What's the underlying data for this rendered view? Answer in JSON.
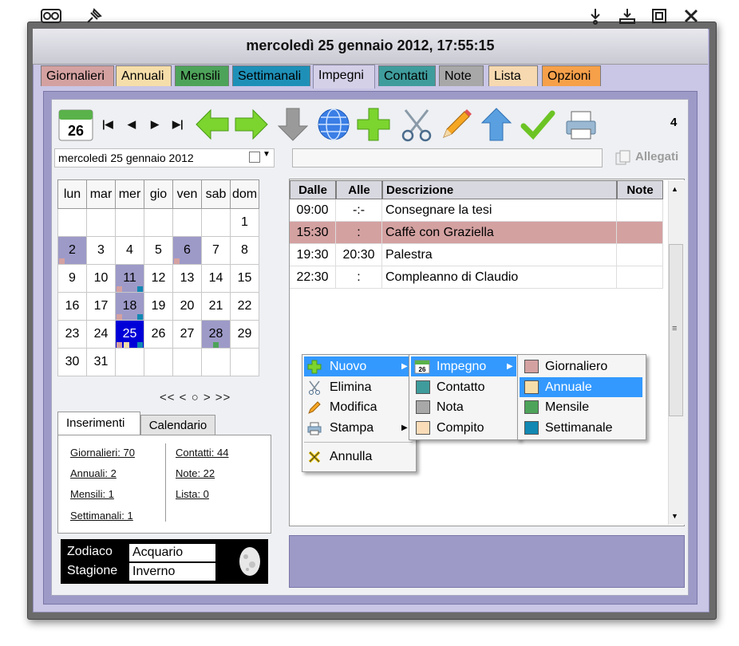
{
  "window": {
    "title": "mercoledì 25 gennaio 2012,  17:55:15"
  },
  "tabs": [
    {
      "label": "Giornalieri",
      "color": "#d4a1a1"
    },
    {
      "label": "Annuali",
      "color": "#f6deaa"
    },
    {
      "label": "Mensili",
      "color": "#4ea35a"
    },
    {
      "label": "Settimanali",
      "color": "#1e90b8"
    },
    {
      "label": "Impegni",
      "color": "#d4d0e8"
    },
    {
      "label": "Contatti",
      "color": "#3f9c9c"
    },
    {
      "label": "Note",
      "color": "#a8a8a8"
    },
    {
      "label": "Lista",
      "color": "#f6d9b0"
    },
    {
      "label": "Opzioni",
      "color": "#f6a04a"
    }
  ],
  "toolbar": {
    "calendar_badge": "26",
    "nav": [
      "|◀",
      "◀",
      "▶",
      "▶|"
    ],
    "count": "4"
  },
  "date_combo": {
    "value": "mercoledì 25  gennaio  2012"
  },
  "allegati_label": "Allegati",
  "calendar": {
    "headers": [
      "lun",
      "mar",
      "mer",
      "gio",
      "ven",
      "sab",
      "dom"
    ],
    "rows": [
      [
        "",
        "",
        "",
        "",
        "",
        "",
        "1"
      ],
      [
        "2",
        "3",
        "4",
        "5",
        "6",
        "7",
        "8"
      ],
      [
        "9",
        "10",
        "11",
        "12",
        "13",
        "14",
        "15"
      ],
      [
        "16",
        "17",
        "18",
        "19",
        "20",
        "21",
        "22"
      ],
      [
        "23",
        "24",
        "25",
        "26",
        "27",
        "28",
        "29"
      ],
      [
        "30",
        "31",
        "",
        "",
        "",
        "",
        ""
      ]
    ],
    "month_nav": "<<  <  ○  >  >>"
  },
  "side_tabs": {
    "inserimenti": "Inserimenti",
    "calendario": "Calendario"
  },
  "stats": {
    "giornalieri": "Giornalieri: 70",
    "annuali": "Annuali: 2",
    "mensili": "Mensili: 1",
    "settimanali": "Settimanali: 1",
    "contatti": "Contatti: 44",
    "note": "Note: 22",
    "lista": "Lista: 0"
  },
  "zodiac": {
    "zodiaco_label": "Zodiaco",
    "zodiaco_value": "Acquario",
    "stagione_label": "Stagione",
    "stagione_value": "Inverno"
  },
  "appointments": {
    "headers": {
      "dalle": "Dalle",
      "alle": "Alle",
      "descrizione": "Descrizione",
      "note": "Note"
    },
    "rows": [
      {
        "dalle": "09:00",
        "alle": "-:-",
        "descrizione": "Consegnare la tesi",
        "note": ""
      },
      {
        "dalle": "15:30",
        "alle": ":",
        "descrizione": "Caffè con Graziella",
        "note": ""
      },
      {
        "dalle": "19:30",
        "alle": "20:30",
        "descrizione": "Palestra",
        "note": ""
      },
      {
        "dalle": "22:30",
        "alle": ":",
        "descrizione": "Compleanno di Claudio",
        "note": ""
      }
    ]
  },
  "context_menu": {
    "main": [
      "Nuovo",
      "Elimina",
      "Modifica",
      "Stampa",
      "Annulla"
    ],
    "nuovo_sub": [
      "Impegno",
      "Contatto",
      "Nota",
      "Compito"
    ],
    "impegno_sub": [
      "Giornaliero",
      "Annuale",
      "Mensile",
      "Settimanale"
    ],
    "impegno_icon_label": "26"
  },
  "colors": {
    "giornaliero": "#d4a1a1",
    "annuale": "#f6deaa",
    "mensile": "#4ea35a",
    "settimanale": "#1288b2",
    "contatto": "#3f9c9c",
    "nota": "#a8a8a8",
    "compito": "#fbdcb8",
    "highlight_row": "#d4a1a1",
    "menu_highlight": "#3399ff"
  }
}
